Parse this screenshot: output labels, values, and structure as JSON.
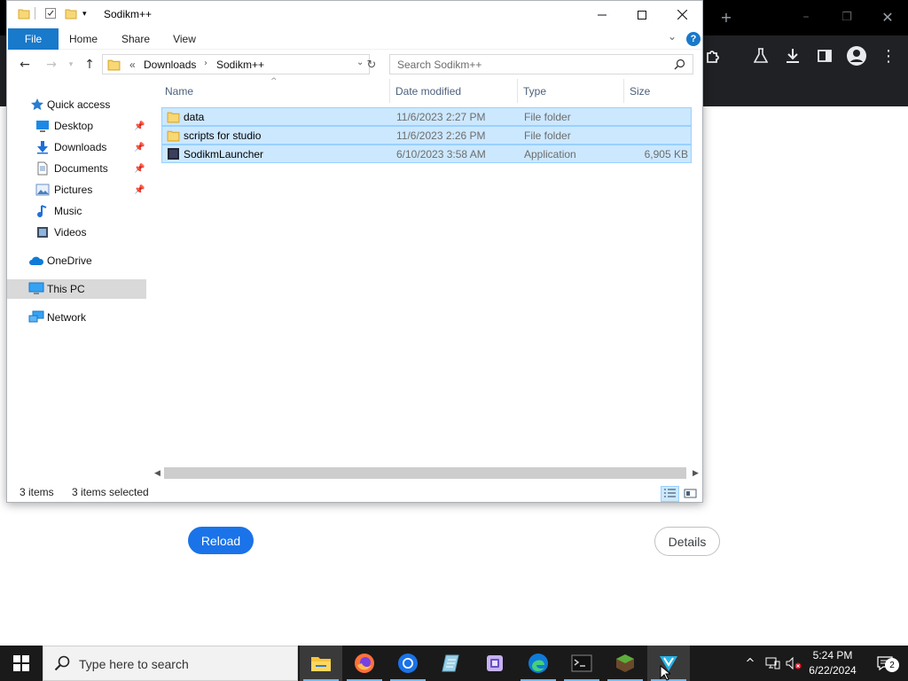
{
  "explorer": {
    "title": "Sodikm++",
    "ribbon_tabs": [
      "File",
      "Home",
      "Share",
      "View"
    ],
    "help_label": "?",
    "address": {
      "overflow": "«",
      "segments": [
        "Downloads",
        "Sodikm++"
      ]
    },
    "search_placeholder": "Search Sodikm++",
    "nav_pane": [
      {
        "label": "Quick access",
        "icon": "star-icon",
        "pinned": false
      },
      {
        "label": "Desktop",
        "icon": "desktop-icon",
        "pinned": true
      },
      {
        "label": "Downloads",
        "icon": "download-arrow-icon",
        "pinned": true
      },
      {
        "label": "Documents",
        "icon": "documents-icon",
        "pinned": true
      },
      {
        "label": "Pictures",
        "icon": "pictures-icon",
        "pinned": true
      },
      {
        "label": "Music",
        "icon": "music-note-icon",
        "pinned": false
      },
      {
        "label": "Videos",
        "icon": "videos-icon",
        "pinned": false
      },
      {
        "label": "OneDrive",
        "icon": "cloud-icon",
        "pinned": false
      },
      {
        "label": "This PC",
        "icon": "monitor-icon",
        "pinned": false,
        "selected": true
      },
      {
        "label": "Network",
        "icon": "network-icon",
        "pinned": false
      }
    ],
    "columns": [
      "Name",
      "Date modified",
      "Type",
      "Size"
    ],
    "files": [
      {
        "name": "data",
        "modified": "11/6/2023 2:27 PM",
        "type": "File folder",
        "size": "",
        "icon": "folder-icon"
      },
      {
        "name": "scripts for studio",
        "modified": "11/6/2023 2:26 PM",
        "type": "File folder",
        "size": "",
        "icon": "folder-icon"
      },
      {
        "name": "SodikmLauncher",
        "modified": "6/10/2023 3:58 AM",
        "type": "Application",
        "size": "6,905 KB",
        "icon": "app-icon"
      }
    ],
    "status": {
      "count": "3 items",
      "selected": "3 items selected"
    }
  },
  "browser": {
    "reload_label": "Reload",
    "details_label": "Details"
  },
  "taskbar": {
    "search_placeholder": "Type here to search",
    "apps": [
      "file-explorer-icon",
      "firefox-icon",
      "chrome-icon",
      "notes-icon",
      "purple-app-icon",
      "edge-icon",
      "terminal-icon",
      "minecraft-icon",
      "vpn-icon"
    ],
    "time": "5:24 PM",
    "date": "6/22/2024",
    "notification_count": "2"
  },
  "colors": {
    "selection": "#cce8ff",
    "selection_border": "#99d1ff",
    "ribbon_file": "#1979ca",
    "browser_accent": "#1a73e8"
  }
}
